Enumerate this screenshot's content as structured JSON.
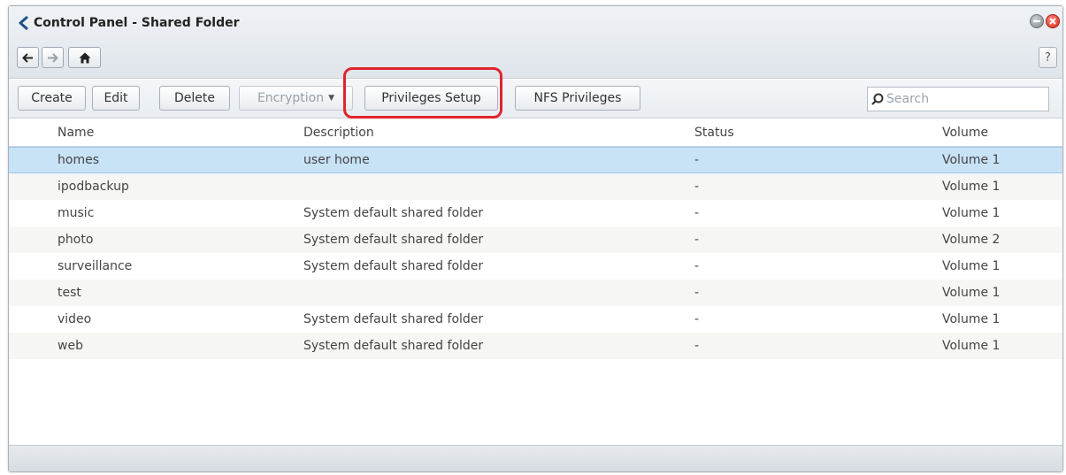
{
  "window": {
    "title": "Control Panel - Shared Folder",
    "help_label": "?"
  },
  "nav": {
    "back_icon": "arrow-left-icon",
    "forward_icon": "arrow-right-icon",
    "home_icon": "home-icon"
  },
  "toolbar": {
    "create_label": "Create",
    "edit_label": "Edit",
    "delete_label": "Delete",
    "encryption_label": "Encryption",
    "privileges_label": "Privileges Setup",
    "nfs_label": "NFS Privileges"
  },
  "search": {
    "placeholder": "Search"
  },
  "table": {
    "columns": [
      "Name",
      "Description",
      "Status",
      "Volume"
    ],
    "rows": [
      {
        "name": "homes",
        "description": "user home",
        "status": "-",
        "volume": "Volume 1"
      },
      {
        "name": "ipodbackup",
        "description": "",
        "status": "-",
        "volume": "Volume 1"
      },
      {
        "name": "music",
        "description": "System default shared folder",
        "status": "-",
        "volume": "Volume 1"
      },
      {
        "name": "photo",
        "description": "System default shared folder",
        "status": "-",
        "volume": "Volume 2"
      },
      {
        "name": "surveillance",
        "description": "System default shared folder",
        "status": "-",
        "volume": "Volume 1"
      },
      {
        "name": "test",
        "description": "",
        "status": "-",
        "volume": "Volume 1"
      },
      {
        "name": "video",
        "description": "System default shared folder",
        "status": "-",
        "volume": "Volume 1"
      },
      {
        "name": "web",
        "description": "System default shared folder",
        "status": "-",
        "volume": "Volume 1"
      }
    ]
  },
  "colors": {
    "selection": "#c8e2f6",
    "highlight": "#e0242c",
    "close": "#d8281a"
  }
}
